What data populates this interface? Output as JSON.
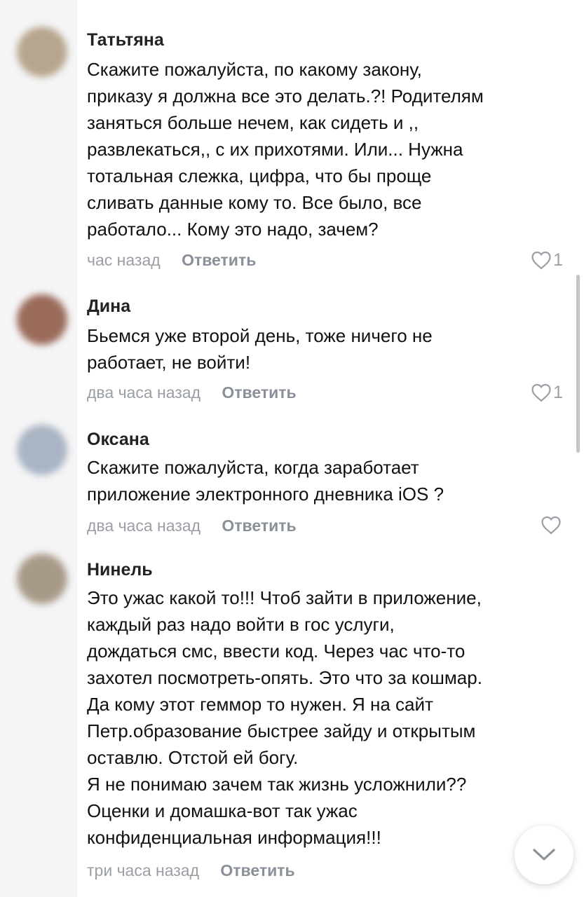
{
  "comments": [
    {
      "author": "Татьтяна",
      "lines": [
        "Скажите пожалуйста, по какому закону,",
        "приказу я должна все это  делать.?! Родителям",
        "заняться больше нечем, как сидеть и ,,",
        "развлекаться,, с их прихотями. Или... Нужна",
        "тотальная слежка, цифра, что бы проще",
        "сливать данные кому то. Все было, все",
        "работало... Кому это надо, зачем?"
      ],
      "time": "час назад",
      "reply_label": "Ответить",
      "likes": "1",
      "avatar_color": "#b7a68e"
    },
    {
      "author": "Дина",
      "lines": [
        "Бьемся уже второй день, тоже ничего не",
        "работает, не войти!"
      ],
      "time": "два часа назад",
      "reply_label": "Ответить",
      "likes": "1",
      "avatar_color": "#9a6a5a"
    },
    {
      "author": "Оксана",
      "lines": [
        "Скажите пожалуйста, когда заработает",
        "приложение электронного дневника iOS ?"
      ],
      "time": "два часа назад",
      "reply_label": "Ответить",
      "likes": "",
      "avatar_color": "#a9b4c4"
    },
    {
      "author": "Нинель",
      "lines": [
        "Это ужас какой то!!! Чтоб зайти в приложение,",
        "каждый раз надо войти в гос услуги,",
        "дождаться смс, ввести код. Через час что-то",
        "захотел посмотреть-опять. Это что за кошмар.",
        "Да кому этот геммор то нужен. Я на сайт",
        "Петр.образование быстрее зайду и открытым",
        "оставлю. Отстой ей богу.",
        "Я не понимаю зачем так жизнь усложнили??",
        "Оценки и домашка-вот так ужас",
        "конфиденциальная информация!!!"
      ],
      "time": "три часа назад",
      "reply_label": "Ответить",
      "likes": "",
      "avatar_color": "#a89a88"
    }
  ],
  "icons": {
    "like": "heart-icon",
    "scroll_down": "chevron-down-icon"
  }
}
